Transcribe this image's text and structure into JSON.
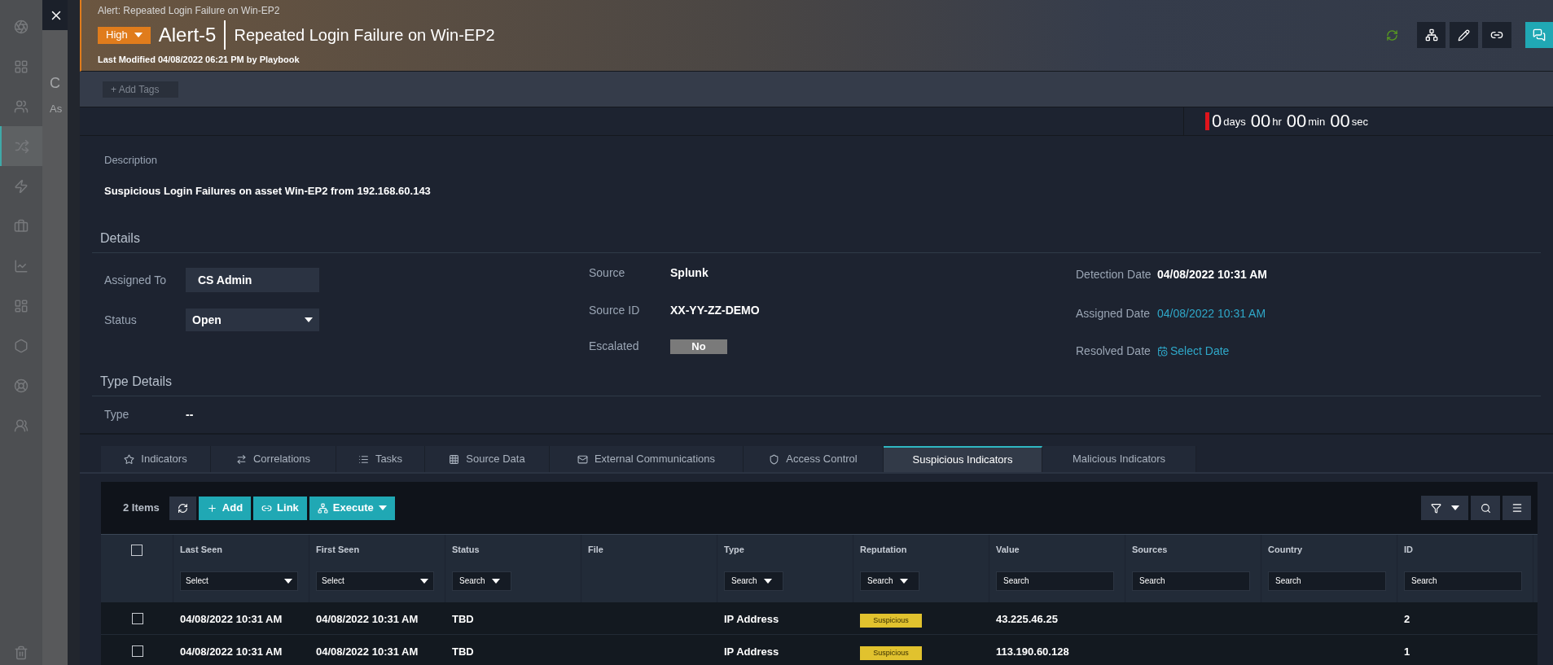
{
  "background_page": {
    "texts": [
      "C",
      "As"
    ]
  },
  "sidebar": {
    "items": [
      {
        "selected": false
      },
      {
        "selected": false
      },
      {
        "selected": false
      },
      {
        "selected": true
      },
      {
        "selected": false
      },
      {
        "selected": false
      },
      {
        "selected": false
      },
      {
        "selected": false
      },
      {
        "selected": false
      },
      {
        "selected": false
      },
      {
        "selected": false
      },
      {
        "selected": false
      }
    ]
  },
  "header": {
    "breadcrumb": "Alert: Repeated Login Failure on Win-EP2",
    "severity": "High",
    "record_id": "Alert-5",
    "title": "Repeated Login Failure on Win-EP2",
    "modified": "Last Modified 04/08/2022 06:21 PM by Playbook"
  },
  "tags": {
    "button": "+ Add Tags"
  },
  "timer": [
    {
      "value": "0",
      "unit": "days"
    },
    {
      "value": "00",
      "unit": "hr"
    },
    {
      "value": "00",
      "unit": "min"
    },
    {
      "value": "00",
      "unit": "sec"
    }
  ],
  "description": {
    "label": "Description",
    "text": "Suspicious Login Failures on asset Win-EP2 from 192.168.60.143"
  },
  "details": {
    "heading": "Details",
    "columns": [
      [
        {
          "kind": "input",
          "label": "Assigned To",
          "value": "CS Admin"
        },
        {
          "kind": "select",
          "label": "Status",
          "value": "Open"
        }
      ],
      [
        {
          "kind": "text",
          "label": "Source",
          "value": "Splunk"
        },
        {
          "kind": "text",
          "label": "Source ID",
          "value": "XX-YY-ZZ-DEMO"
        },
        {
          "kind": "toggle",
          "label": "Escalated",
          "value": "No",
          "on": false
        }
      ],
      [
        {
          "kind": "text",
          "label": "Detection Date",
          "value": "04/08/2022 10:31 AM"
        },
        {
          "kind": "link",
          "label": "Assigned Date",
          "value": "04/08/2022 10:31 AM"
        },
        {
          "kind": "date_picker",
          "label": "Resolved Date",
          "value": "Select Date"
        }
      ]
    ]
  },
  "type_details": {
    "heading": "Type Details",
    "fields": [
      {
        "label": "Type",
        "value": "--"
      }
    ]
  },
  "tabs": [
    {
      "label": "Indicators",
      "selected": false
    },
    {
      "label": "Correlations",
      "selected": false
    },
    {
      "label": "Tasks",
      "selected": false
    },
    {
      "label": "Source Data",
      "selected": false
    },
    {
      "label": "External Communications",
      "selected": false
    },
    {
      "label": "Access Control",
      "selected": false
    },
    {
      "label": "Suspicious Indicators",
      "selected": true
    },
    {
      "label": "Malicious Indicators",
      "selected": false
    }
  ],
  "table": {
    "count": "2 Items",
    "buttons": [
      "Add",
      "Link",
      "Execute"
    ],
    "select_all": {
      "checked": false
    },
    "columns": [
      {
        "label": "Last Seen",
        "filter": {
          "kind": "select",
          "text": "Select"
        }
      },
      {
        "label": "First Seen",
        "filter": {
          "kind": "select",
          "text": "Select"
        }
      },
      {
        "label": "Status",
        "filter": {
          "kind": "dropdown",
          "text": "Search"
        }
      },
      {
        "label": "File"
      },
      {
        "label": "Type",
        "filter": {
          "kind": "dropdown",
          "text": "Search"
        }
      },
      {
        "label": "Reputation",
        "filter": {
          "kind": "dropdown",
          "text": "Search"
        }
      },
      {
        "label": "Value",
        "filter": {
          "kind": "input",
          "placeholder": "Search"
        }
      },
      {
        "label": "Sources",
        "filter": {
          "kind": "input",
          "placeholder": "Search"
        }
      },
      {
        "label": "Country",
        "filter": {
          "kind": "input",
          "placeholder": "Search"
        }
      },
      {
        "label": "ID",
        "filter": {
          "kind": "input",
          "placeholder": "Search"
        }
      }
    ],
    "rows": [
      {
        "checked": false,
        "cells": [
          {
            "text": "04/08/2022 10:31 AM"
          },
          {
            "text": "04/08/2022 10:31 AM"
          },
          {
            "text": "TBD"
          },
          {},
          {
            "text": "IP Address"
          },
          {
            "kind": "badge",
            "text": "Suspicious"
          },
          {
            "text": "43.225.46.25"
          },
          {},
          {},
          {
            "text": "2"
          }
        ]
      },
      {
        "checked": false,
        "cells": [
          {
            "text": "04/08/2022 10:31 AM"
          },
          {
            "text": "04/08/2022 10:31 AM"
          },
          {
            "text": "TBD"
          },
          {},
          {
            "text": "IP Address"
          },
          {
            "kind": "badge",
            "text": "Suspicious"
          },
          {
            "text": "113.190.60.128"
          },
          {},
          {},
          {
            "text": "1"
          }
        ]
      }
    ]
  }
}
